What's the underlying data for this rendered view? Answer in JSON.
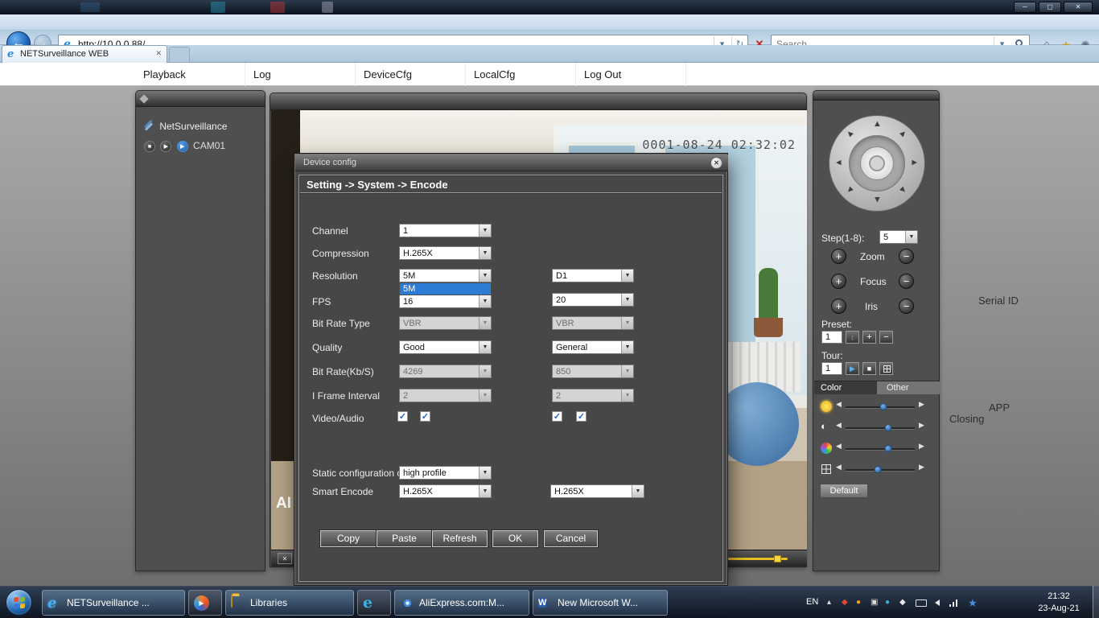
{
  "icons": {
    "minimize": "─",
    "maximize": "▢",
    "close": "✕",
    "back": "←",
    "forward": "→",
    "refresh": "↻",
    "dropdown": "▾",
    "stop": "✕",
    "home": "⌂",
    "favorites": "★",
    "tools": "✺",
    "tab_close": "✕",
    "favicon": "e",
    "combo_arrow": "▼",
    "check": "✓",
    "plus": "+",
    "minus": "−",
    "play": "▶",
    "stop_square": "■",
    "updown": "↕",
    "left": "◀",
    "right": "▶",
    "up": "▲",
    "contrast": "◐",
    "hidden_chevron": "▴",
    "dot": "●",
    "diamond": "◆",
    "square_icon": "▣",
    "cam_stop": "■",
    "cam_play": "▶",
    "word_w": "W"
  },
  "colors": {
    "accent_blue": "#2e7bd6",
    "slider_knob": "#4a86c8",
    "volume_yellow": "#f0c830"
  },
  "chrome": {
    "url": "http://10.0.0.88/",
    "search_placeholder": "Search...",
    "tab_title": "NETSurveillance WEB"
  },
  "menu": {
    "items": [
      "Playback",
      "Log",
      "DeviceCfg",
      "LocalCfg",
      "Log Out"
    ]
  },
  "sidebar": {
    "root": "NetSurveillance",
    "camera": "CAM01"
  },
  "video": {
    "timestamp": "0001-08-24 02:32:02",
    "overlay": "AI"
  },
  "dialog": {
    "title": "Device config",
    "path": "Setting -> System -> Encode",
    "labels": {
      "channel": "Channel",
      "compression": "Compression",
      "resolution": "Resolution",
      "fps": "FPS",
      "bit_rate_type": "Bit Rate Type",
      "quality": "Quality",
      "bit_rate": "Bit Rate(Kb/S)",
      "i_frame": "I Frame Interval",
      "video_audio": "Video/Audio",
      "static_config": "Static configuration of",
      "smart_encode": "Smart Encode"
    },
    "values": {
      "channel": "1",
      "compression": "H.265X",
      "resolution": "5M",
      "resolution2": "D1",
      "fps": "16",
      "fps2": "20",
      "bit_rate_type": "VBR",
      "bit_rate_type2": "VBR",
      "quality": "Good",
      "quality2": "General",
      "bit_rate": "4269",
      "bit_rate2": "850",
      "i_frame": "2",
      "i_frame2": "2",
      "static_config": "high profile",
      "smart_encode": "H.265X",
      "smart_encode2": "H.265X"
    },
    "dropdown_item": "5M",
    "buttons": [
      "Copy",
      "Paste",
      "Refresh",
      "OK",
      "Cancel"
    ]
  },
  "ptz": {
    "step_label": "Step(1-8):",
    "step_value": "5",
    "zoom_label": "Zoom",
    "focus_label": "Focus",
    "iris_label": "Iris",
    "preset_label": "Preset:",
    "preset_value": "1",
    "tour_label": "Tour:",
    "tour_value": "1",
    "tabs": [
      "Color",
      "Other"
    ],
    "default_label": "Default",
    "sliders": [
      {
        "name": "brightness",
        "value": 55
      },
      {
        "name": "contrast",
        "value": 62
      },
      {
        "name": "saturation",
        "value": 62
      },
      {
        "name": "sharpness",
        "value": 47
      }
    ]
  },
  "page": {
    "serial_id": "Serial ID",
    "app": "APP",
    "closing": "Closing"
  },
  "taskbar": {
    "ie_window": "NETSurveillance ...",
    "libraries": "Libraries",
    "chrome_window": "AliExpress.com:M...",
    "word_window": "New Microsoft W...",
    "lang": "EN",
    "time": "21:32",
    "date": "23-Aug-21"
  }
}
